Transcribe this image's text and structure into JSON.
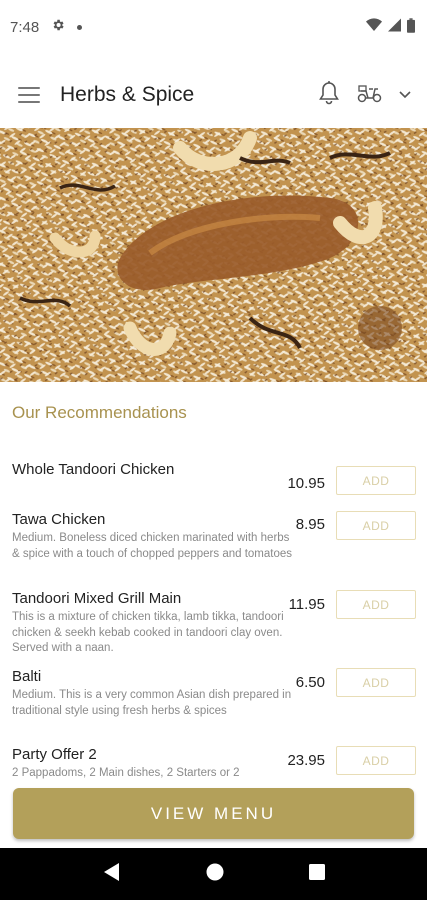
{
  "status_bar": {
    "time": "7:48",
    "icons": [
      "gear-icon",
      "notification-dot",
      "wifi-icon",
      "signal-icon",
      "battery-icon"
    ]
  },
  "app_bar": {
    "title": "Herbs & Spice",
    "icons": [
      "menu-icon",
      "bell-icon",
      "delivery-scooter-icon",
      "chevron-down-icon"
    ]
  },
  "hero_image": {
    "subject": "biryani-photo"
  },
  "section_title": "Our Recommendations",
  "items": [
    {
      "name": "Whole Tandoori Chicken",
      "description": "",
      "price": "10.95",
      "button": "ADD"
    },
    {
      "name": "Tawa Chicken",
      "description": "Medium. Boneless diced chicken marinated with herbs & spice with a touch of chopped peppers and tomatoes",
      "price": "8.95",
      "button": "ADD"
    },
    {
      "name": "Tandoori Mixed Grill Main",
      "description": "This is a mixture of chicken tikka, lamb tikka, tandoori chicken & seekh kebab cooked in tandoori clay oven. Served with a naan.",
      "price": "11.95",
      "button": "ADD"
    },
    {
      "name": "Balti",
      "description": "Medium. This is a very common Asian dish prepared in traditional style using fresh herbs & spices",
      "price": "6.50",
      "button": "ADD"
    },
    {
      "name": "Party Offer 2",
      "description": "2 Pappadoms, 2 Main dishes, 2 Starters or 2",
      "price": "23.95",
      "button": "ADD"
    }
  ],
  "view_menu_label": "VIEW MENU",
  "colors": {
    "accent": "#b3a05a",
    "section_title": "#a8924f",
    "add_border": "#e8ddb6"
  },
  "nav_bar": {
    "icons": [
      "back-icon",
      "home-icon",
      "recents-icon"
    ]
  }
}
